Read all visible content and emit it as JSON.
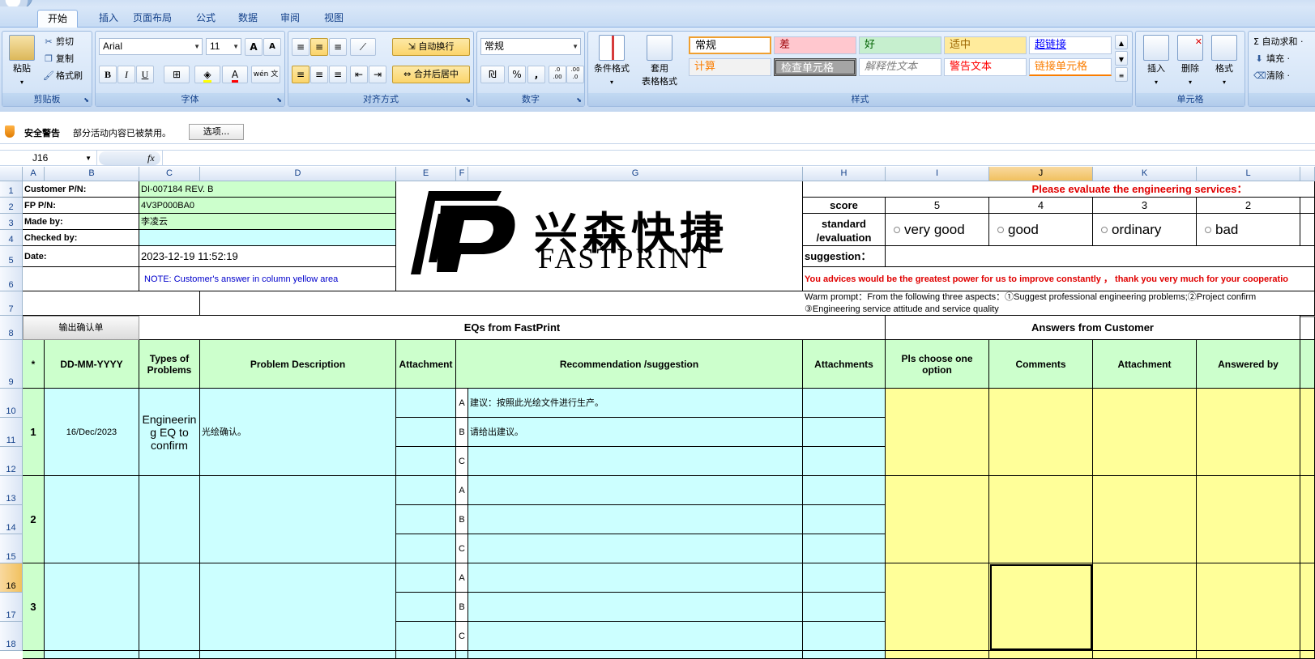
{
  "ribbon": {
    "tabs": [
      "开始",
      "插入",
      "页面布局",
      "公式",
      "数据",
      "审阅",
      "视图"
    ],
    "active_tab": "开始",
    "clipboard": {
      "paste": "粘贴",
      "cut": "剪切",
      "copy": "复制",
      "format_painter": "格式刷",
      "label": "剪贴板"
    },
    "font": {
      "name": "Arial",
      "size": "11",
      "label": "字体",
      "bold": "B",
      "italic": "I",
      "underline": "U",
      "grow": "A",
      "shrink": "A",
      "phonetic": "wén 文",
      "font_color": "A"
    },
    "alignment": {
      "wrap": "自动换行",
      "merge": "合并后居中",
      "label": "对齐方式"
    },
    "number": {
      "format": "常规",
      "percent": "%",
      "comma": ",",
      "inc_decimal": ".0 .00",
      "dec_decimal": ".00 .0",
      "label": "数字"
    },
    "styles": {
      "cond_format": "条件格式",
      "table_format_1": "套用",
      "table_format_2": "表格格式",
      "label": "样式",
      "cells": [
        {
          "text": "常规",
          "color": "#000000",
          "bg": "#ffffff"
        },
        {
          "text": "差",
          "color": "#9c0006",
          "bg": "#ffc7ce"
        },
        {
          "text": "好",
          "color": "#006100",
          "bg": "#c6efce"
        },
        {
          "text": "适中",
          "color": "#9c6500",
          "bg": "#ffeb9c"
        },
        {
          "text": "超链接",
          "color": "#0000ff",
          "bg": "#ffffff"
        },
        {
          "text": "计算",
          "color": "#fa7d00",
          "bg": "#f2f2f2"
        },
        {
          "text": "检查单元格",
          "color": "#ffffff",
          "bg": "#a5a5a5"
        },
        {
          "text": "解释性文本",
          "color": "#7f7f7f",
          "bg": "#ffffff"
        },
        {
          "text": "警告文本",
          "color": "#ff0000",
          "bg": "#ffffff"
        },
        {
          "text": "链接单元格",
          "color": "#fa7d00",
          "bg": "#ffffff"
        }
      ]
    },
    "cells_group": {
      "insert": "插入",
      "delete": "删除",
      "format": "格式",
      "label": "单元格"
    },
    "editing": {
      "autosum": "Σ 自动求和 ·",
      "fill": "填充 ·",
      "clear": "清除 ·"
    }
  },
  "security": {
    "title": "安全警告",
    "message": "部分活动内容已被禁用。",
    "button": "选项..."
  },
  "formula_bar": {
    "name_box": "J16",
    "fx": "fx",
    "value": ""
  },
  "columns": [
    "A",
    "B",
    "C",
    "D",
    "E",
    "F",
    "G",
    "H",
    "I",
    "J",
    "K",
    "L"
  ],
  "rows": [
    "1",
    "2",
    "3",
    "4",
    "5",
    "6",
    "7",
    "8",
    "9",
    "10",
    "11",
    "12",
    "13",
    "14",
    "15",
    "16",
    "17",
    "18"
  ],
  "sheet": {
    "labels": {
      "customer_pn": "Customer P/N:",
      "fp_pn": "FP P/N:",
      "made_by": "Made by:",
      "checked_by": "Checked by:",
      "date": "Date:"
    },
    "values": {
      "customer_pn": "DI-007184 REV. B",
      "fp_pn": "4V3P000BA0",
      "made_by": "李凌云",
      "checked_by": "",
      "date": "2023-12-19 11:52:19"
    },
    "note": "NOTE: Customer's  answer in column yellow area",
    "logo": {
      "cn": "兴森快捷",
      "en": "FASTPRINT"
    },
    "eval_title": "Please evaluate the engineering services：",
    "score_label": "score",
    "scores": [
      "5",
      "4",
      "3",
      "2"
    ],
    "standard_label": "standard /evaluation",
    "standard_line1": "standard",
    "standard_line2": "/evaluation",
    "options": [
      "very good",
      "good",
      "ordinary",
      "bad"
    ],
    "suggestion_label": "suggestion：",
    "advice": "You advices would be the greatest power for us to improve constantly ，  thank you very much for your cooperatio",
    "prompt_1": "Warm prompt：From the following three aspects：①Suggest professional engineering problems;②Project confirm",
    "prompt_2": "③Engineering service attitude and service quality",
    "output_btn": "输出确认单",
    "eqs_header": "EQs from FastPrint",
    "answers_header": "Answers from Customer",
    "headers": {
      "star": "*",
      "date": "DD-MM-YYYY",
      "types": "Types of Problems",
      "problem": "Problem Description",
      "attachment": "Attachment",
      "recommendation": "Recommendation /suggestion",
      "attachments": "Attachments",
      "choose": "Pls choose one option",
      "comments": "Comments",
      "cust_attachment": "Attachment",
      "answered_by": "Answered by"
    },
    "eq_rows": [
      {
        "no": "1",
        "date": "16/Dec/2023",
        "type": "Engineering EQ to confirm",
        "type_l1": "Engineerin",
        "type_l2": "g EQ to",
        "type_l3": "confirm",
        "problem": "光绘确认。",
        "opts": [
          {
            "letter": "A",
            "text": "建议：按照此光绘文件进行生产。"
          },
          {
            "letter": "B",
            "text": "请给出建议。"
          },
          {
            "letter": "C",
            "text": ""
          }
        ]
      },
      {
        "no": "2",
        "date": "",
        "type": "",
        "problem": "",
        "opts": [
          {
            "letter": "A",
            "text": ""
          },
          {
            "letter": "B",
            "text": ""
          },
          {
            "letter": "C",
            "text": ""
          }
        ]
      },
      {
        "no": "3",
        "date": "",
        "type": "",
        "problem": "",
        "opts": [
          {
            "letter": "A",
            "text": ""
          },
          {
            "letter": "B",
            "text": ""
          },
          {
            "letter": "C",
            "text": ""
          }
        ]
      }
    ]
  },
  "colors": {
    "green": "#ccffcc",
    "cyan": "#ccffff",
    "yellow": "#ffff99",
    "red_text": "#e00000",
    "note_blue": "#0000cc",
    "ribbon_text": "#15428b"
  }
}
